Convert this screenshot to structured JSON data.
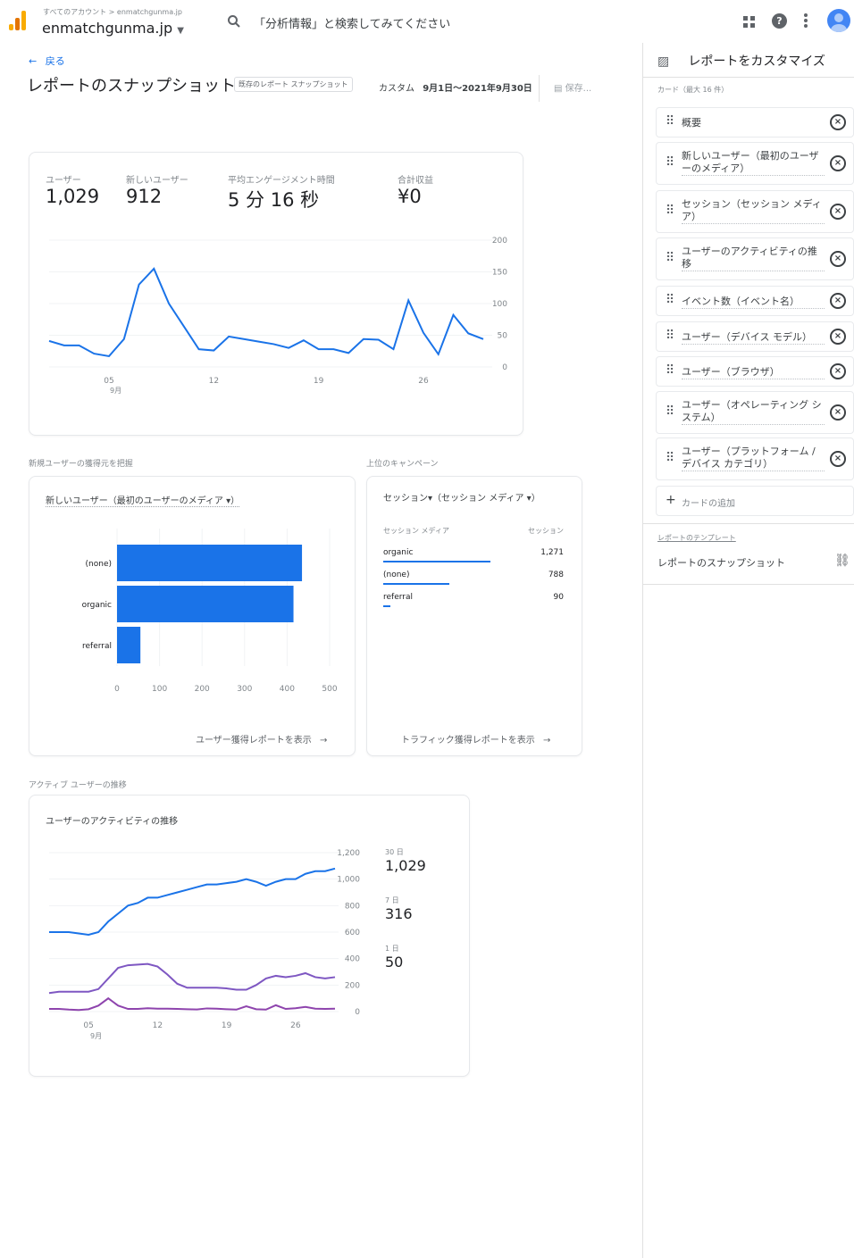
{
  "header": {
    "breadcrumb": "すべてのアカウント > enmatchgunma.jp",
    "account": "enmatchgunma.jp",
    "search_placeholder": "「分析情報」と検索してみてください"
  },
  "page": {
    "back_label": "戻る",
    "title": "レポートのスナップショット",
    "badge": "既存のレポート スナップショット",
    "date_prefix": "カスタム",
    "date_range": "9月1日～2021年9月30日",
    "export_label": "保存..."
  },
  "overview": {
    "metrics": [
      {
        "label": "ユーザー",
        "value": "1,029"
      },
      {
        "label": "新しいユーザー",
        "value": "912"
      },
      {
        "label": "平均エンゲージメント時間",
        "value": "5 分 16 秒"
      },
      {
        "label": "合計収益",
        "value": "¥0"
      }
    ],
    "y_ticks": [
      "200",
      "150",
      "100",
      "50",
      "0"
    ],
    "x_ticks": [
      "05",
      "12",
      "19",
      "26"
    ],
    "x_sub": "9月"
  },
  "acquisition": {
    "section_title": "新規ユーザーの獲得元を把握",
    "card_title": "新しいユーザー（最初のユーザーのメディア ▾）",
    "x_ticks": [
      "0",
      "100",
      "200",
      "300",
      "400",
      "500"
    ],
    "link": "ユーザー獲得レポートを表示"
  },
  "campaigns": {
    "section_title": "上位のキャンペーン",
    "card_title": "セッション▾（セッション メディア ▾）",
    "col1": "セッション メディア",
    "col2": "セッション",
    "rows": [
      {
        "label": "organic",
        "value": "1,271"
      },
      {
        "label": "(none)",
        "value": "788"
      },
      {
        "label": "referral",
        "value": "90"
      }
    ],
    "link": "トラフィック獲得レポートを表示"
  },
  "active_users": {
    "section_title": "アクティブ ユーザーの推移",
    "card_title": "ユーザーのアクティビティの推移",
    "y_ticks": [
      "1,200",
      "1,000",
      "800",
      "600",
      "400",
      "200",
      "0"
    ],
    "x_ticks": [
      "05",
      "12",
      "19",
      "26"
    ],
    "x_sub": "9月",
    "legend": [
      {
        "label": "30 日",
        "value": "1,029"
      },
      {
        "label": "7 日",
        "value": "316"
      },
      {
        "label": "1 日",
        "value": "50"
      }
    ]
  },
  "right_panel": {
    "title": "レポートをカスタマイズ",
    "cards_label": "カード（最大 16 件）",
    "items": [
      "概要",
      "新しいユーザー（最初のユーザーのメディア）",
      "セッション（セッション メディア）",
      "ユーザーのアクティビティの推移",
      "イベント数（イベント名）",
      "ユーザー（デバイス モデル）",
      "ユーザー（ブラウザ）",
      "ユーザー（オペレーティング システム）",
      "ユーザー（プラットフォーム / デバイス カテゴリ）"
    ],
    "add_card": "カードの追加",
    "template_label": "レポートのテンプレート",
    "template_value": "レポートのスナップショット"
  },
  "chart_data": [
    {
      "type": "line",
      "x": [
        "09-01",
        "09-02",
        "09-03",
        "09-04",
        "09-05",
        "09-06",
        "09-07",
        "09-08",
        "09-09",
        "09-10",
        "09-11",
        "09-12",
        "09-13",
        "09-14",
        "09-15",
        "09-16",
        "09-17",
        "09-18",
        "09-19",
        "09-20",
        "09-21",
        "09-22",
        "09-23",
        "09-24",
        "09-25",
        "09-26",
        "09-27",
        "09-28",
        "09-29",
        "09-30"
      ],
      "series": [
        {
          "values": [
            41,
            34,
            34,
            21,
            17,
            44,
            130,
            155,
            100,
            64,
            28,
            26,
            48,
            44,
            40,
            36,
            30,
            42,
            28,
            28,
            22,
            44,
            43,
            28,
            105,
            54,
            20,
            82,
            53,
            44
          ]
        }
      ],
      "ylim": [
        0,
        200
      ],
      "y_ticks": [
        0,
        50,
        100,
        150,
        200
      ],
      "x_ticks": [
        "05",
        "12",
        "19",
        "26"
      ]
    },
    {
      "type": "bar",
      "orientation": "horizontal",
      "categories": [
        "(none)",
        "organic",
        "referral"
      ],
      "values": [
        435,
        415,
        55
      ],
      "xlim": [
        0,
        500
      ]
    },
    {
      "type": "table",
      "columns": [
        "セッション メディア",
        "セッション"
      ],
      "rows": [
        [
          "organic",
          1271
        ],
        [
          "(none)",
          788
        ],
        [
          "referral",
          90
        ]
      ]
    },
    {
      "type": "line",
      "series": [
        {
          "name": "30 日",
          "values": [
            600,
            600,
            600,
            590,
            580,
            600,
            680,
            740,
            800,
            820,
            860,
            860,
            880,
            900,
            920,
            940,
            960,
            960,
            970,
            980,
            1000,
            980,
            950,
            980,
            1000,
            1000,
            1040,
            1060,
            1060,
            1080
          ]
        },
        {
          "name": "7 日",
          "values": [
            140,
            150,
            150,
            150,
            150,
            170,
            250,
            330,
            350,
            355,
            360,
            340,
            280,
            210,
            180,
            180,
            180,
            180,
            175,
            165,
            165,
            200,
            250,
            270,
            260,
            270,
            290,
            260,
            250,
            260
          ]
        },
        {
          "name": "1 日",
          "values": [
            20,
            20,
            15,
            12,
            18,
            45,
            100,
            45,
            20,
            20,
            25,
            22,
            22,
            20,
            18,
            16,
            24,
            22,
            18,
            15,
            40,
            18,
            15,
            48,
            20,
            25,
            35,
            22,
            20,
            22
          ]
        }
      ],
      "ylim": [
        0,
        1200
      ],
      "y_ticks": [
        0,
        200,
        400,
        600,
        800,
        1000,
        1200
      ],
      "x_ticks": [
        "05",
        "12",
        "19",
        "26"
      ]
    }
  ]
}
